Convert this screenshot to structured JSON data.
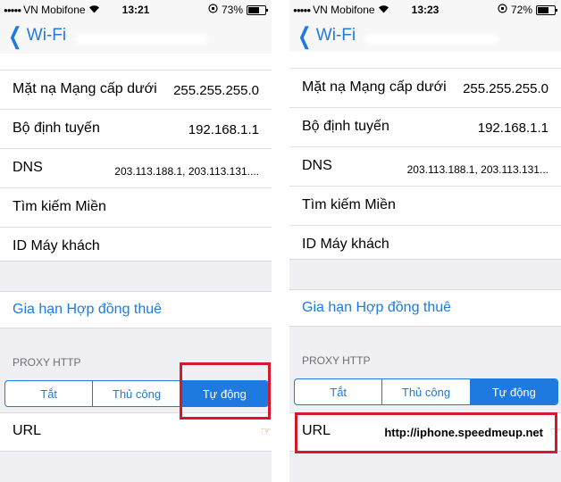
{
  "left": {
    "status": {
      "carrier": "VN Mobifone",
      "time": "13:21",
      "battery": "73%",
      "battery_level": 0.73
    },
    "nav": {
      "back_label": "Wi-Fi"
    },
    "rows": [
      {
        "label": "Mặt nạ Mạng cấp dưới",
        "value": "255.255.255.0"
      },
      {
        "label": "Bộ định tuyến",
        "value": "192.168.1.1"
      },
      {
        "label": "DNS",
        "value": "203.113.188.1, 203.113.131...."
      },
      {
        "label": "Tìm kiếm Miền",
        "value": ""
      },
      {
        "label": "ID Máy khách",
        "value": ""
      }
    ],
    "renew_label": "Gia hạn Hợp đồng thuê",
    "proxy_header": "PROXY HTTP",
    "segments": [
      "Tắt",
      "Thủ công",
      "Tự động"
    ],
    "selected_segment": "Tự động",
    "url_label": "URL",
    "url_value": ""
  },
  "right": {
    "status": {
      "carrier": "VN Mobifone",
      "time": "13:23",
      "battery": "72%",
      "battery_level": 0.72
    },
    "nav": {
      "back_label": "Wi-Fi"
    },
    "rows": [
      {
        "label": "Mặt nạ Mạng cấp dưới",
        "value": "255.255.255.0"
      },
      {
        "label": "Bộ định tuyến",
        "value": "192.168.1.1"
      },
      {
        "label": "DNS",
        "value": "203.113.188.1, 203.113.131..."
      },
      {
        "label": "Tìm kiếm Miền",
        "value": ""
      },
      {
        "label": "ID Máy khách",
        "value": ""
      }
    ],
    "renew_label": "Gia hạn Hợp đồng thuê",
    "proxy_header": "PROXY HTTP",
    "segments": [
      "Tắt",
      "Thủ công",
      "Tự động"
    ],
    "selected_segment": "Tự động",
    "url_label": "URL",
    "url_value": "http://iphone.speedmeup.net"
  },
  "colors": {
    "accent": "#1f7ae0",
    "highlight": "#d6192a",
    "background": "#efeff4"
  }
}
